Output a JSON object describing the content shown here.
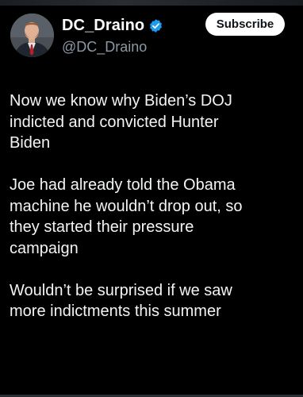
{
  "profile": {
    "display_name": "DC_Draino",
    "handle": "@DC_Draino",
    "avatar_icon": "profile-photo",
    "verified_icon": "verified-badge-icon",
    "verified_color": "#1d9bf0"
  },
  "actions": {
    "subscribe_label": "Subscribe"
  },
  "tweet": {
    "paragraphs": [
      "Now we know why Biden’s DOJ\nindicted and convicted Hunter\nBiden",
      "Joe had already told the Obama\nmachine he wouldn’t drop out, so\nthey started their pressure\ncampaign",
      "Wouldn’t be surprised if we saw\nmore indictments this summer"
    ]
  },
  "theme": {
    "background": "#000000",
    "text_primary": "#e7e9ea",
    "text_secondary": "#8b98a5",
    "button_bg": "#ffffff"
  }
}
